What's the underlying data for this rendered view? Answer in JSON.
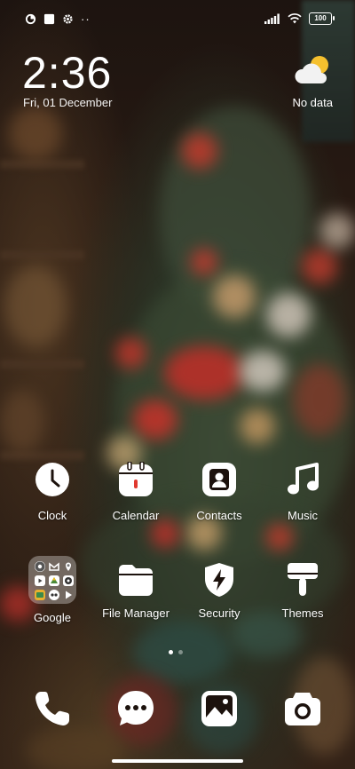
{
  "status": {
    "battery": "100"
  },
  "clock": {
    "time": "2:36",
    "date": "Fri, 01 December"
  },
  "weather": {
    "icon": "partly-cloudy-icon",
    "label": "No data"
  },
  "apps_row1": [
    {
      "label": "Clock",
      "icon": "clock-icon"
    },
    {
      "label": "Calendar",
      "icon": "calendar-icon"
    },
    {
      "label": "Contacts",
      "icon": "contacts-icon"
    },
    {
      "label": "Music",
      "icon": "music-note-icon"
    }
  ],
  "apps_row2": [
    {
      "label": "Google",
      "icon": "folder-icon"
    },
    {
      "label": "File Manager",
      "icon": "file-manager-icon"
    },
    {
      "label": "Security",
      "icon": "shield-bolt-icon"
    },
    {
      "label": "Themes",
      "icon": "paint-brush-icon"
    }
  ],
  "page_indicator": {
    "pages": 2,
    "current": 1
  },
  "dock": [
    "phone-icon",
    "messages-icon",
    "gallery-icon",
    "camera-icon"
  ],
  "colors": {
    "icon_fg": "#ffffff",
    "glyph_bg": "#1c120d"
  }
}
